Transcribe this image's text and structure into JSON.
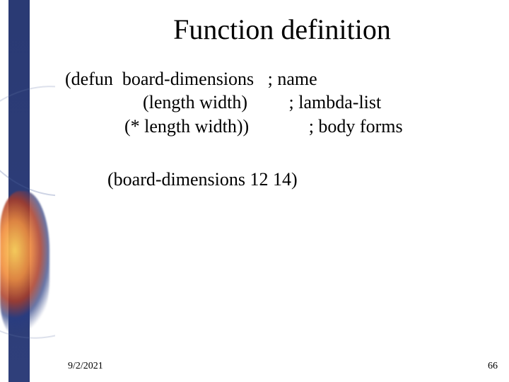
{
  "title": "Function definition",
  "code": {
    "line1_left": "(defun  board-dimensions   ; name",
    "line2_left": "(length width)",
    "line2_right": "; lambda-list",
    "line3_left": "(* length width))",
    "line3_right": "; body forms",
    "call": "(board-dimensions 12 14)"
  },
  "footer": {
    "date": "9/2/2021",
    "page": "66"
  }
}
